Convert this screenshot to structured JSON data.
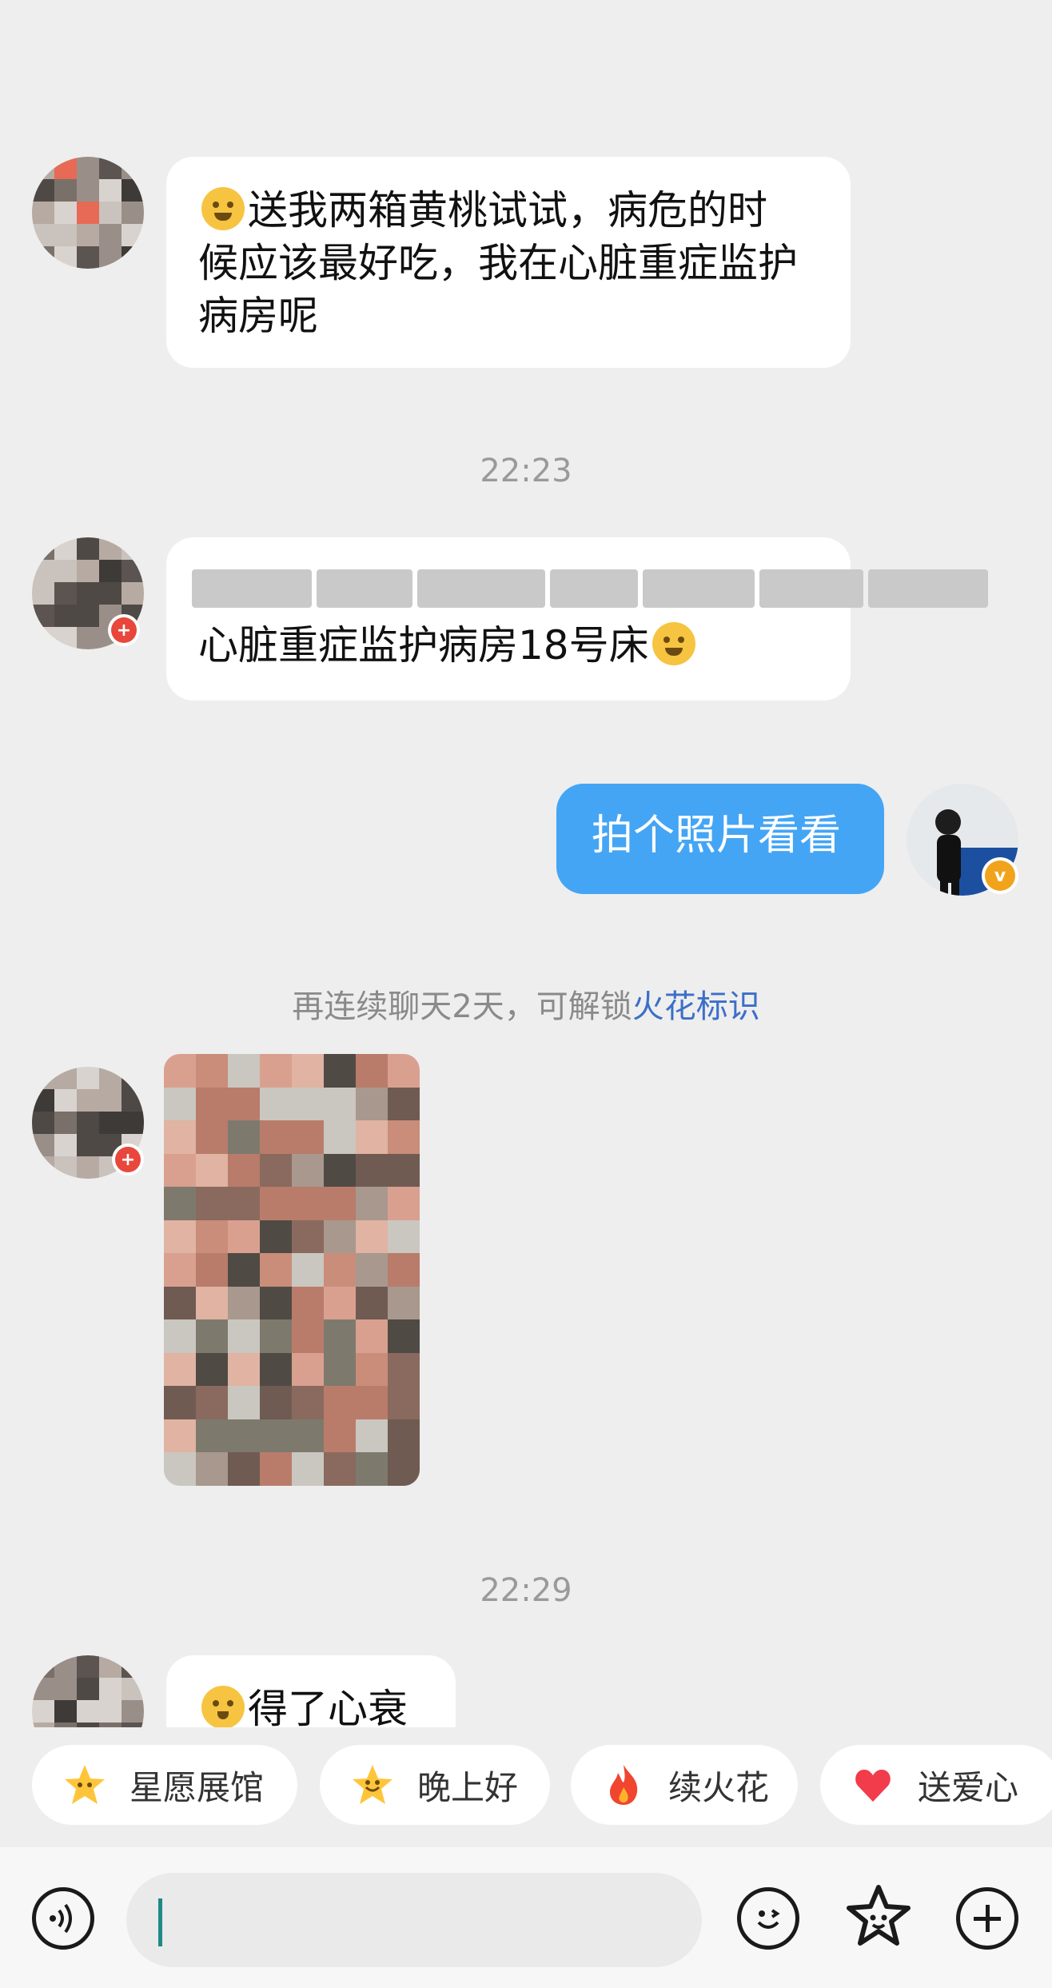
{
  "messages": {
    "m1_text": "送我两箱黄桃试试，病危的时候应该最好吃，我在心脏重症监护病房呢",
    "time1": "22:23",
    "m2_text": "心脏重症监护病房18号床",
    "m3_text": "拍个照片看看",
    "hint_prefix": "再连续聊天2天，可解锁",
    "hint_link": "火花标识",
    "time2": "22:29",
    "m5_text": "得了心衰"
  },
  "quick_replies": [
    {
      "label": "星愿展馆",
      "icon": "star-face-icon"
    },
    {
      "label": "晚上好",
      "icon": "star-smile-icon"
    },
    {
      "label": "续火花",
      "icon": "fire-icon"
    },
    {
      "label": "送爱心",
      "icon": "heart-icon"
    }
  ],
  "colors": {
    "my_bubble": "#44a5f5",
    "link": "#3b6fc9",
    "background": "#eeeeee"
  }
}
